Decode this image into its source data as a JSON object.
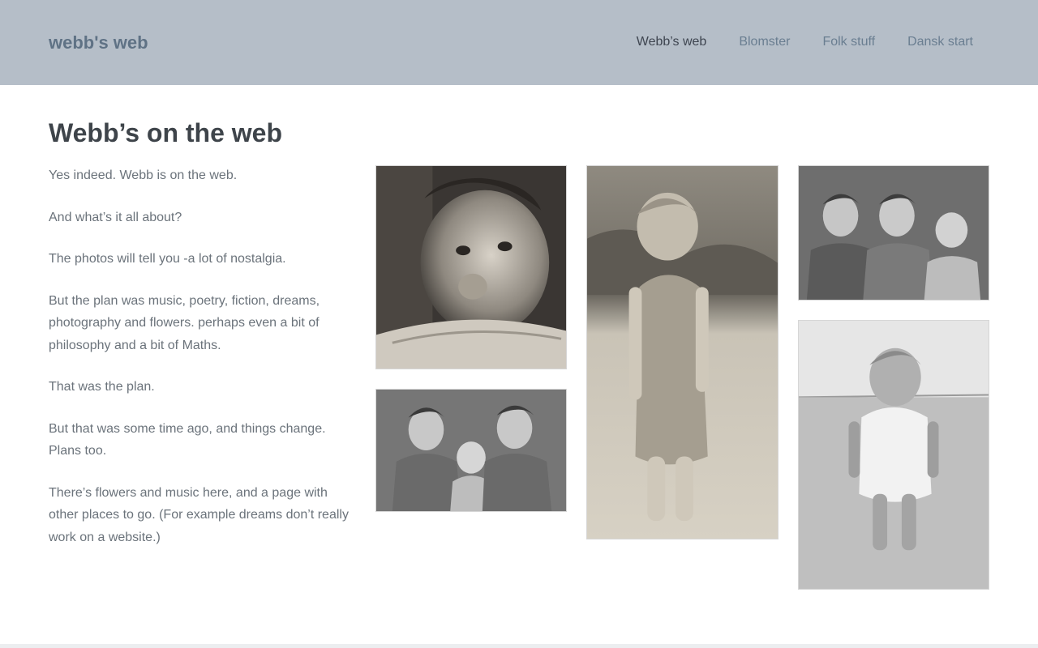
{
  "header": {
    "site_title": "webb's web",
    "nav": [
      {
        "label": "Webb’s web",
        "active": true
      },
      {
        "label": "Blomster"
      },
      {
        "label": "Folk stuff"
      },
      {
        "label": "Dansk start"
      }
    ]
  },
  "main": {
    "heading": "Webb’s on the web",
    "paragraphs": [
      "Yes indeed. Webb is on the web.",
      "And what’s it all about?",
      "The photos will tell you -a lot of nostalgia.",
      "But the plan was music, poetry, fiction, dreams, photography and flowers. perhaps even a bit of philosophy and a bit of Maths.",
      "That was the plan.",
      "But that was some time ago, and things change. Plans too.",
      "There’s flowers and music here, and a page with other places to go. (For example dreams don’t really work on a website.)"
    ]
  },
  "colors": {
    "header_bg": "#b5bec8",
    "site_title": "#5f7285",
    "nav_link": "#6a7e91",
    "nav_active": "#3e4550",
    "heading": "#3e444a",
    "body_text": "#6b737b"
  }
}
